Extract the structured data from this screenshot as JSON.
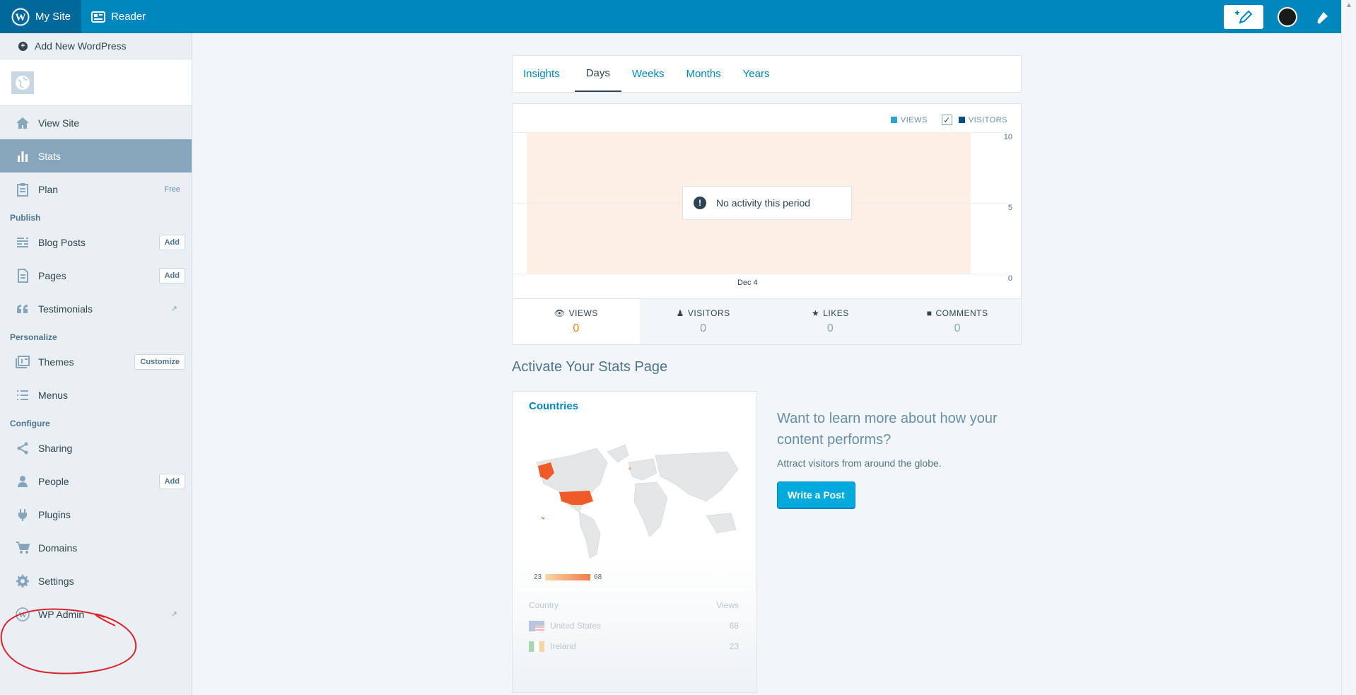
{
  "masterbar": {
    "my_site": "My Site",
    "reader": "Reader"
  },
  "sidebar": {
    "add_new": "Add New WordPress",
    "items": [
      {
        "label": "View Site"
      },
      {
        "label": "Stats"
      },
      {
        "label": "Plan",
        "badge": "Free"
      }
    ],
    "sections": {
      "publish": "Publish",
      "personalize": "Personalize",
      "configure": "Configure"
    },
    "publish_items": [
      {
        "label": "Blog Posts",
        "button": "Add"
      },
      {
        "label": "Pages",
        "button": "Add"
      },
      {
        "label": "Testimonials"
      }
    ],
    "personalize_items": [
      {
        "label": "Themes",
        "button": "Customize"
      },
      {
        "label": "Menus"
      }
    ],
    "configure_items": [
      {
        "label": "Sharing"
      },
      {
        "label": "People",
        "button": "Add"
      },
      {
        "label": "Plugins"
      },
      {
        "label": "Domains"
      },
      {
        "label": "Settings"
      },
      {
        "label": "WP Admin"
      }
    ]
  },
  "tabs": [
    "Insights",
    "Days",
    "Weeks",
    "Months",
    "Years"
  ],
  "active_tab": "Days",
  "chart_data": {
    "type": "bar",
    "legend": [
      "VIEWS",
      "VISITORS"
    ],
    "categories": [
      "Dec 4"
    ],
    "y_ticks": [
      "10",
      "5",
      "0"
    ],
    "ylim": [
      0,
      10
    ],
    "empty_message": "No activity this period",
    "colors": {
      "views": "#2ea2cc",
      "visitors": "#005082",
      "background": "#fcf0e5"
    }
  },
  "summary": [
    {
      "label": "VIEWS",
      "value": "0",
      "icon": "eye-icon"
    },
    {
      "label": "VISITORS",
      "value": "0",
      "icon": "person-icon"
    },
    {
      "label": "LIKES",
      "value": "0",
      "icon": "star-icon"
    },
    {
      "label": "COMMENTS",
      "value": "0",
      "icon": "comment-icon"
    }
  ],
  "activate_title": "Activate Your Stats Page",
  "countries": {
    "title": "Countries",
    "scale_min": "23",
    "scale_max": "68",
    "col_country": "Country",
    "col_views": "Views",
    "rows": [
      {
        "country": "United States",
        "views": "68"
      },
      {
        "country": "Ireland",
        "views": "23"
      }
    ]
  },
  "promo": {
    "title": "Want to learn more about how your content performs?",
    "subtitle": "Attract visitors from around the globe.",
    "button": "Write a Post"
  }
}
